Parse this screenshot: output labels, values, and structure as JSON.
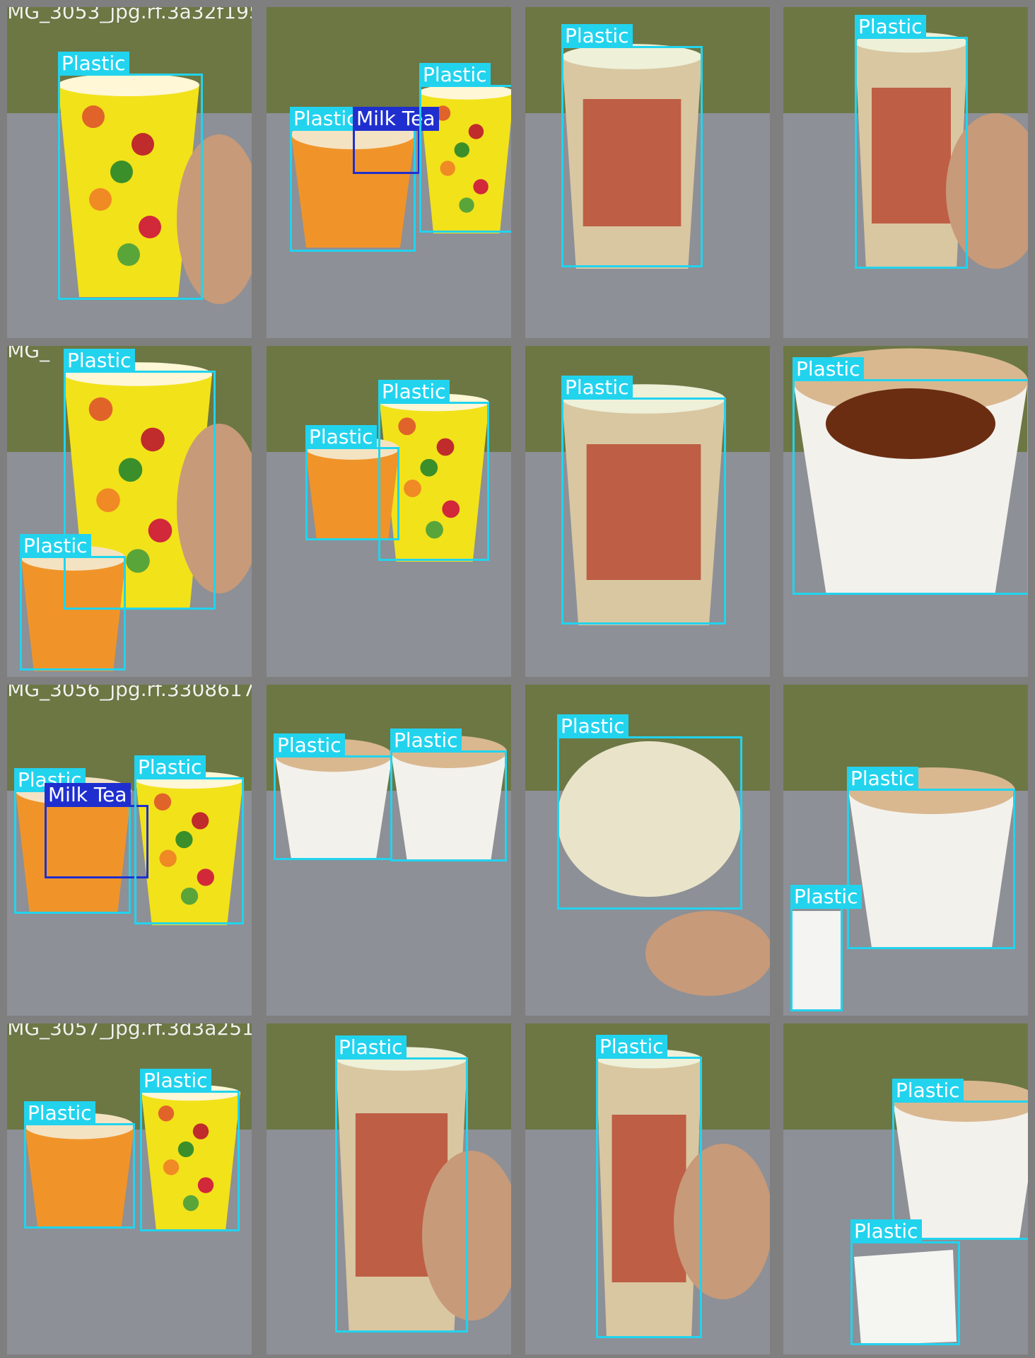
{
  "grid": {
    "cell_color": "#7f7f7f",
    "tiles": [
      {
        "filename": "IMG_3053_jpg.rf.3a32f195b74873658065920b68ab7a96b17a06d5fa10655dd809b6a5f0b7dc859f1c",
        "scene": "yellow-cup-hand",
        "detections": [
          {
            "class": "Plastic"
          }
        ]
      },
      {
        "filename": "",
        "scene": "orange-bowl-yellow-cup",
        "detections": [
          {
            "class": "Plastic"
          },
          {
            "class": "Milk Tea"
          },
          {
            "class": "Plastic"
          }
        ]
      },
      {
        "filename": "",
        "scene": "fruitas-cup-back",
        "detections": [
          {
            "class": "Plastic"
          }
        ]
      },
      {
        "filename": "",
        "scene": "fruitas-cup-hand",
        "detections": [
          {
            "class": "Plastic"
          }
        ]
      },
      {
        "filename": "IMG_",
        "scene": "yellow-cup-and-orange-bowl",
        "detections": [
          {
            "class": "Plastic"
          },
          {
            "class": "Plastic"
          }
        ]
      },
      {
        "filename": "",
        "scene": "orange-bowl-yellow-cup-table",
        "detections": [
          {
            "class": "Plastic"
          },
          {
            "class": "Plastic"
          }
        ]
      },
      {
        "filename": "",
        "scene": "fruitas-cup-lid",
        "detections": [
          {
            "class": "Plastic"
          }
        ]
      },
      {
        "filename": "",
        "scene": "mad-rice-bowl-food",
        "detections": [
          {
            "class": "Plastic"
          }
        ]
      },
      {
        "filename": "IMG_3056_jpg.rf.330861775c9d0284f3f5f2d94f9af4f32e699a441debb1b771c6a1490b9fd04a760f8",
        "scene": "bowl-and-cup-milk-tea",
        "detections": [
          {
            "class": "Plastic"
          },
          {
            "class": "Milk Tea"
          },
          {
            "class": "Plastic"
          }
        ]
      },
      {
        "filename": "",
        "scene": "two-empty-cups",
        "detections": [
          {
            "class": "Plastic"
          },
          {
            "class": "Plastic"
          }
        ]
      },
      {
        "filename": "",
        "scene": "clear-lid-cup-hand",
        "detections": [
          {
            "class": "Plastic"
          }
        ]
      },
      {
        "filename": "",
        "scene": "mad-rice-empty-tissue",
        "detections": [
          {
            "class": "Plastic"
          },
          {
            "class": "Plastic"
          }
        ]
      },
      {
        "filename": "IMG_3057_jpg.rf.3d3a251e8b9f5a3c9f3cb0de7e69d39b8c39c6b6116ec1440fda1f2e65b7c",
        "scene": "orange-bowl-yellow-cup-2",
        "detections": [
          {
            "class": "Plastic"
          },
          {
            "class": "Plastic"
          }
        ]
      },
      {
        "filename": "",
        "scene": "fruitas-nutrition-hand",
        "detections": [
          {
            "class": "Plastic"
          }
        ]
      },
      {
        "filename": "",
        "scene": "fruitas-cup-upside",
        "detections": [
          {
            "class": "Plastic"
          }
        ]
      },
      {
        "filename": "",
        "scene": "mad-rice-bowl-tissue",
        "detections": [
          {
            "class": "Plastic"
          },
          {
            "class": "Plastic"
          }
        ]
      }
    ]
  },
  "colors": {
    "plastic": "#22d3ee",
    "milk_tea": "#1f2fcf",
    "label_text": "#ffffff"
  }
}
